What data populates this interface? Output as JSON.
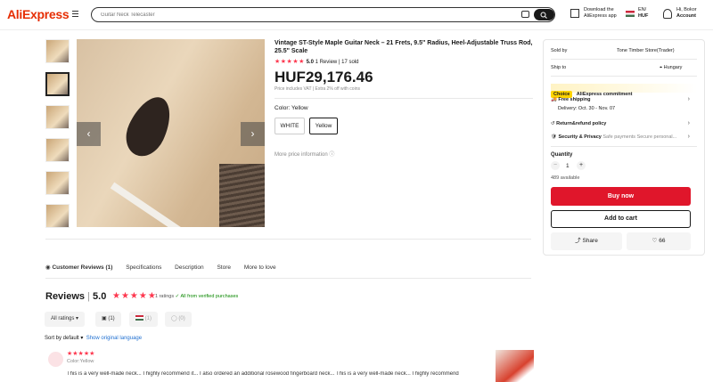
{
  "header": {
    "logo": "AliExpress",
    "search_placeholder": "Guitar Neck Telecaster",
    "download_line1": "Download the",
    "download_line2": "AliExpress app",
    "lang_line1": "EN/",
    "lang_line2": "HUF",
    "account_line1": "Hi, Bokor",
    "account_line2": "Account"
  },
  "product": {
    "title": "Vintage ST-Style Maple Guitar Neck – 21 Frets, 9.5\" Radius, Heel-Adjustable Truss Rod, 25.5\" Scale",
    "rating": "5.0",
    "reviews": "1 Review",
    "sold": "17 sold",
    "price": "HUF29,176.46",
    "tax_note": "Price includes VAT | Extra 2% off with coins",
    "color_label": "Color: Yellow",
    "options": [
      "WHITE",
      "Yellow"
    ],
    "more_info": "More price information"
  },
  "panel": {
    "sold_by_label": "Sold by",
    "sold_by": "Tone Timber Store(Trader)",
    "ship_to_label": "Ship to",
    "ship_to": "Hungary",
    "choice_badge": "Choice",
    "commitment": "AliExpress commitment",
    "free_shipping": "Free shipping",
    "delivery": "Delivery: Oct. 30 - Nov. 07",
    "return": "Return&refund policy",
    "security": "Security & Privacy",
    "security_sub": "Safe payments Secure personal...",
    "quantity_label": "Quantity",
    "quantity": "1",
    "available": "489 available",
    "buy_now": "Buy now",
    "add_to_cart": "Add to cart",
    "share": "Share",
    "likes": "66"
  },
  "tabs": [
    "Customer Reviews (1)",
    "Specifications",
    "Description",
    "Store",
    "More to love"
  ],
  "reviews": {
    "heading": "Reviews",
    "score": "5.0",
    "ratings": "1 ratings",
    "verified": "All from verified purchases",
    "filters": [
      "All ratings",
      "(1)",
      "(1)",
      "(0)"
    ],
    "sort": "Sort by default",
    "original": "Show original language",
    "item_color": "Color:Yellow",
    "text": "This is a very well-made neck... I highly recommend it... I also ordered an additional rosewood fingerboard neck... This is a very well-made neck... I highly recommend"
  }
}
